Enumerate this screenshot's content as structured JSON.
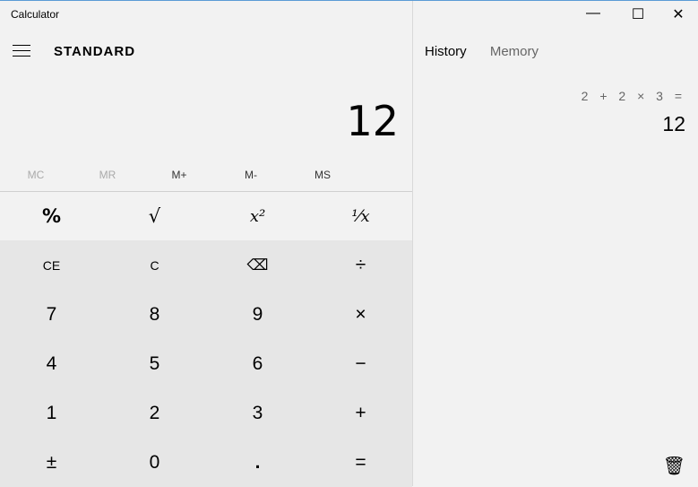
{
  "window": {
    "title": "Calculator",
    "minimize": "—",
    "maximize": "☐",
    "close": "✕"
  },
  "header": {
    "mode": "STANDARD",
    "menu_icon": "hamburger-icon"
  },
  "display": {
    "value": "12"
  },
  "memory": [
    "MC",
    "MR",
    "M+",
    "M-",
    "MS"
  ],
  "functions": [
    "%",
    "√",
    "x²",
    "¹⁄x"
  ],
  "keys": [
    [
      "CE",
      "C",
      "⌫",
      "÷"
    ],
    [
      "7",
      "8",
      "9",
      "×"
    ],
    [
      "4",
      "5",
      "6",
      "−"
    ],
    [
      "1",
      "2",
      "3",
      "+"
    ],
    [
      "±",
      "0",
      ".",
      "="
    ]
  ],
  "panel": {
    "tabs": [
      "History",
      "Memory"
    ],
    "history": [
      {
        "expression": "2 + 2 × 3 =",
        "result": "12"
      }
    ],
    "delete_icon": "trash-icon"
  },
  "colors": {
    "accent": "#5b9bd5",
    "keypad": "#e6e6e6",
    "background": "#f2f2f2"
  }
}
